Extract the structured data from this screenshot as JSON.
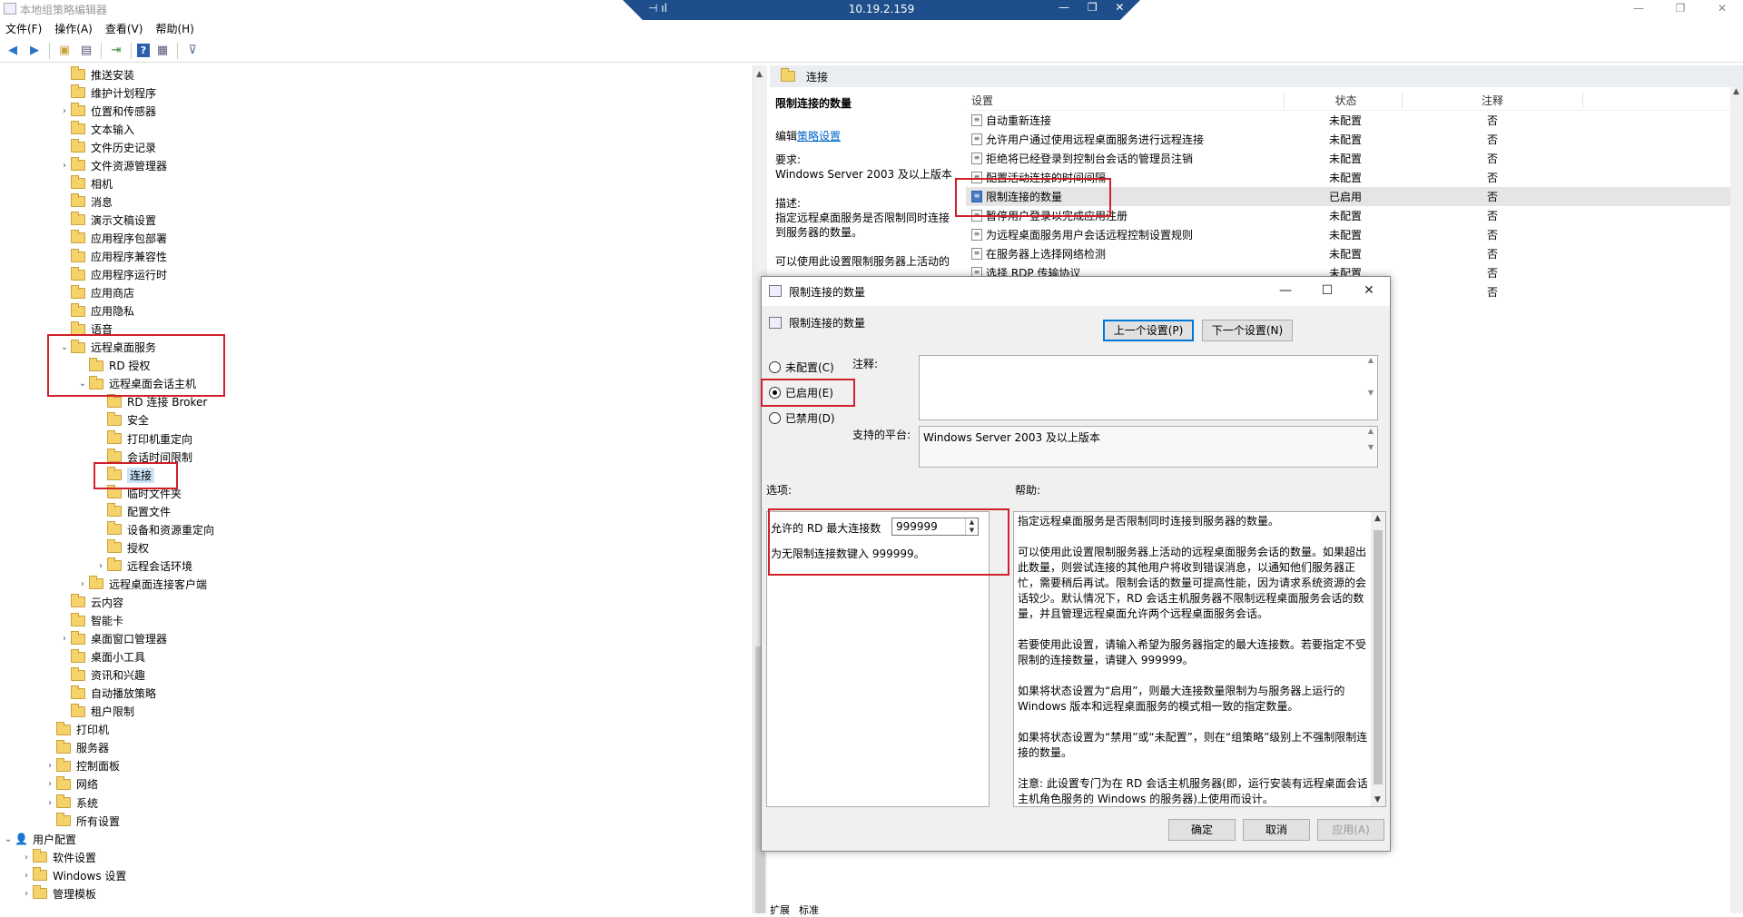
{
  "window": {
    "title": "本地组策略编辑器",
    "controls": [
      "—",
      "❐",
      "✕"
    ]
  },
  "rdp": {
    "ip": "10.19.2.159",
    "left_icons": "⊣ ıl",
    "right_icons": "— ❐ ✕"
  },
  "menu": [
    "文件(F)",
    "操作(A)",
    "查看(V)",
    "帮助(H)"
  ],
  "toolbar": [
    "back-icon",
    "forward-icon",
    "up-folder-icon",
    "show-hide-tree-icon",
    "export-icon",
    "help-icon",
    "properties-icon",
    "filter-icon"
  ],
  "tree": [
    {
      "label": "推送安装",
      "level": 3,
      "exp": ""
    },
    {
      "label": "维护计划程序",
      "level": 3,
      "exp": ""
    },
    {
      "label": "位置和传感器",
      "level": 3,
      "exp": ">"
    },
    {
      "label": "文本输入",
      "level": 3,
      "exp": ""
    },
    {
      "label": "文件历史记录",
      "level": 3,
      "exp": ""
    },
    {
      "label": "文件资源管理器",
      "level": 3,
      "exp": ">"
    },
    {
      "label": "相机",
      "level": 3,
      "exp": ""
    },
    {
      "label": "消息",
      "level": 3,
      "exp": ""
    },
    {
      "label": "演示文稿设置",
      "level": 3,
      "exp": ""
    },
    {
      "label": "应用程序包部署",
      "level": 3,
      "exp": ""
    },
    {
      "label": "应用程序兼容性",
      "level": 3,
      "exp": ""
    },
    {
      "label": "应用程序运行时",
      "level": 3,
      "exp": ""
    },
    {
      "label": "应用商店",
      "level": 3,
      "exp": ""
    },
    {
      "label": "应用隐私",
      "level": 3,
      "exp": ""
    },
    {
      "label": "语音",
      "level": 3,
      "exp": ""
    },
    {
      "label": "远程桌面服务",
      "level": 3,
      "exp": "v"
    },
    {
      "label": "RD 授权",
      "level": 4,
      "exp": ""
    },
    {
      "label": "远程桌面会话主机",
      "level": 4,
      "exp": "v"
    },
    {
      "label": "RD 连接 Broker",
      "level": 5,
      "exp": ""
    },
    {
      "label": "安全",
      "level": 5,
      "exp": ""
    },
    {
      "label": "打印机重定向",
      "level": 5,
      "exp": ""
    },
    {
      "label": "会话时间限制",
      "level": 5,
      "exp": ""
    },
    {
      "label": "连接",
      "level": 5,
      "exp": "",
      "selected": true
    },
    {
      "label": "临时文件夹",
      "level": 5,
      "exp": ""
    },
    {
      "label": "配置文件",
      "level": 5,
      "exp": ""
    },
    {
      "label": "设备和资源重定向",
      "level": 5,
      "exp": ""
    },
    {
      "label": "授权",
      "level": 5,
      "exp": ""
    },
    {
      "label": "远程会话环境",
      "level": 5,
      "exp": ">"
    },
    {
      "label": "远程桌面连接客户端",
      "level": 4,
      "exp": ">"
    },
    {
      "label": "云内容",
      "level": 3,
      "exp": ""
    },
    {
      "label": "智能卡",
      "level": 3,
      "exp": ""
    },
    {
      "label": "桌面窗口管理器",
      "level": 3,
      "exp": ">"
    },
    {
      "label": "桌面小工具",
      "level": 3,
      "exp": ""
    },
    {
      "label": "资讯和兴趣",
      "level": 3,
      "exp": ""
    },
    {
      "label": "自动播放策略",
      "level": 3,
      "exp": ""
    },
    {
      "label": "租户限制",
      "level": 3,
      "exp": ""
    },
    {
      "label": "打印机",
      "level": 2,
      "exp": ""
    },
    {
      "label": "服务器",
      "level": 2,
      "exp": ""
    },
    {
      "label": "控制面板",
      "level": 2,
      "exp": ">"
    },
    {
      "label": "网络",
      "level": 2,
      "exp": ">"
    },
    {
      "label": "系统",
      "level": 2,
      "exp": ">"
    },
    {
      "label": "所有设置",
      "level": 2,
      "exp": ""
    },
    {
      "label": "用户配置",
      "level": 0,
      "exp": "v",
      "user": true
    },
    {
      "label": "软件设置",
      "level": 1,
      "exp": ">"
    },
    {
      "label": "Windows 设置",
      "level": 1,
      "exp": ">"
    },
    {
      "label": "管理模板",
      "level": 1,
      "exp": ">"
    }
  ],
  "right": {
    "header": "连接",
    "desc_title": "限制连接的数量",
    "desc_edit_prefix": "编辑",
    "desc_edit_link": "策略设置",
    "desc_req_label": "要求:",
    "desc_req": "Windows Server 2003 及以上版本",
    "desc_desc_label": "描述:",
    "desc_desc": "指定远程桌面服务是否限制同时连接到服务器的数量。",
    "desc_more": "可以使用此设置限制服务器上活动的",
    "col_setting": "设置",
    "col_state": "状态",
    "col_comment": "注释",
    "rows": [
      {
        "name": "自动重新连接",
        "state": "未配置",
        "comment": "否"
      },
      {
        "name": "允许用户通过使用远程桌面服务进行远程连接",
        "state": "未配置",
        "comment": "否"
      },
      {
        "name": "拒绝将已经登录到控制台会话的管理员注销",
        "state": "未配置",
        "comment": "否"
      },
      {
        "name": "配置活动连接的时间间隔",
        "state": "未配置",
        "comment": "否"
      },
      {
        "name": "限制连接的数量",
        "state": "已启用",
        "comment": "否",
        "selected": true
      },
      {
        "name": "暂停用户登录以完成应用注册",
        "state": "未配置",
        "comment": "否"
      },
      {
        "name": "为远程桌面服务用户会话远程控制设置规则",
        "state": "未配置",
        "comment": "否"
      },
      {
        "name": "在服务器上选择网络检测",
        "state": "未配置",
        "comment": "否"
      },
      {
        "name": "选择 RDP 传输协议",
        "state": "未配置",
        "comment": "否"
      },
      {
        "name": "",
        "state": "",
        "comment": "否"
      }
    ],
    "tabs": [
      "扩展",
      "标准"
    ]
  },
  "dialog": {
    "title": "限制连接的数量",
    "subtitle": "限制连接的数量",
    "prev": "上一个设置(P)",
    "next": "下一个设置(N)",
    "opt_not_configured": "未配置(C)",
    "opt_enabled": "已启用(E)",
    "opt_disabled": "已禁用(D)",
    "comment_label": "注释:",
    "platform_label": "支持的平台:",
    "platform_value": "Windows Server 2003 及以上版本",
    "options_label": "选项:",
    "help_label": "帮助:",
    "max_label": "允许的 RD 最大连接数",
    "max_value": "999999",
    "max_hint": "为无限制连接数键入 999999。",
    "help_text": "指定远程桌面服务是否限制同时连接到服务器的数量。\n\n可以使用此设置限制服务器上活动的远程桌面服务会话的数量。如果超出此数量，则尝试连接的其他用户将收到错误消息，以通知他们服务器正忙，需要稍后再试。限制会话的数量可提高性能，因为请求系统资源的会话较少。默认情况下，RD 会话主机服务器不限制远程桌面服务会话的数量，并且管理远程桌面允许两个远程桌面服务会话。\n\n若要使用此设置，请输入希望为服务器指定的最大连接数。若要指定不受限制的连接数量，请键入 999999。\n\n如果将状态设置为“启用”，则最大连接数量限制为与服务器上运行的 Windows 版本和远程桌面服务的模式相一致的指定数量。\n\n如果将状态设置为“禁用”或“未配置”，则在“组策略”级别上不强制限制连接的数量。\n\n注意: 此设置专门为在 RD 会话主机服务器(即，运行安装有远程桌面会话主机角色服务的 Windows 的服务器)上使用而设计。",
    "ok": "确定",
    "cancel": "取消",
    "apply": "应用(A)"
  },
  "colors": {
    "highlight_red": "#d0202a",
    "selection": "#cce4f7",
    "rdp_bar": "#1e4f8c"
  }
}
